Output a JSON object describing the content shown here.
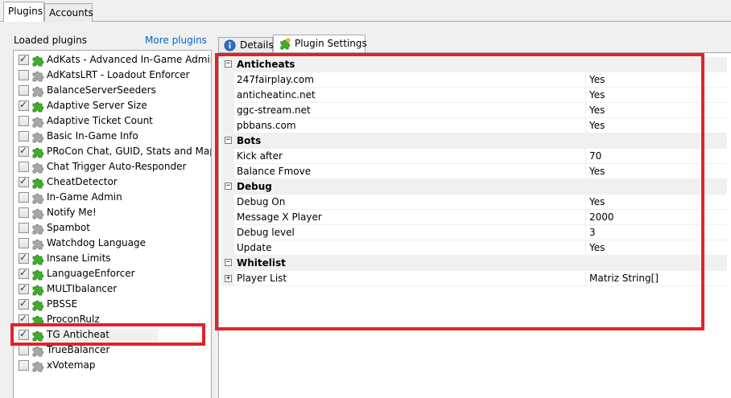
{
  "top_tabs": [
    {
      "label": "Plugins",
      "active": true
    },
    {
      "label": "Accounts",
      "active": false
    }
  ],
  "plugins_panel": {
    "title": "Loaded plugins",
    "more_link": "More plugins",
    "items": [
      {
        "name": "AdKats - Advanced In-Game Admin",
        "checked": true,
        "enabled": true
      },
      {
        "name": "AdKatsLRT - Loadout Enforcer",
        "checked": false,
        "enabled": false
      },
      {
        "name": "BalanceServerSeeders",
        "checked": false,
        "enabled": false
      },
      {
        "name": "Adaptive Server Size",
        "checked": true,
        "enabled": true
      },
      {
        "name": "Adaptive Ticket Count",
        "checked": false,
        "enabled": false
      },
      {
        "name": "Basic In-Game Info",
        "checked": false,
        "enabled": false
      },
      {
        "name": "PRoCon Chat, GUID, Stats and Map Logger",
        "checked": true,
        "enabled": true
      },
      {
        "name": "Chat Trigger Auto-Responder",
        "checked": false,
        "enabled": false
      },
      {
        "name": "CheatDetector",
        "checked": true,
        "enabled": true
      },
      {
        "name": "In-Game Admin",
        "checked": false,
        "enabled": false
      },
      {
        "name": "Notify Me!",
        "checked": false,
        "enabled": false
      },
      {
        "name": "Spambot",
        "checked": false,
        "enabled": false
      },
      {
        "name": "Watchdog Language",
        "checked": false,
        "enabled": false
      },
      {
        "name": "Insane Limits",
        "checked": true,
        "enabled": true
      },
      {
        "name": "LanguageEnforcer",
        "checked": true,
        "enabled": true
      },
      {
        "name": "MULTIbalancer",
        "checked": true,
        "enabled": true
      },
      {
        "name": "PBSSE",
        "checked": true,
        "enabled": true
      },
      {
        "name": "ProconRulz",
        "checked": true,
        "enabled": true
      },
      {
        "name": "TG Anticheat",
        "checked": true,
        "enabled": true,
        "selected": true
      },
      {
        "name": "TrueBalancer",
        "checked": false,
        "enabled": false
      },
      {
        "name": "xVotemap",
        "checked": false,
        "enabled": false
      }
    ]
  },
  "right_tabs": [
    {
      "label": "Details",
      "icon": "info-icon",
      "active": false
    },
    {
      "label": "Plugin Settings",
      "icon": "puzzle-icon",
      "active": true
    }
  ],
  "settings": {
    "categories": [
      {
        "name": "Anticheats",
        "expanded": true,
        "props": [
          {
            "name": "247fairplay.com",
            "value": "Yes"
          },
          {
            "name": "anticheatinc.net",
            "value": "Yes"
          },
          {
            "name": "ggc-stream.net",
            "value": "Yes"
          },
          {
            "name": "pbbans.com",
            "value": "Yes"
          }
        ]
      },
      {
        "name": "Bots",
        "expanded": true,
        "props": [
          {
            "name": "Kick after",
            "value": "70"
          },
          {
            "name": "Balance Fmove",
            "value": "Yes"
          }
        ]
      },
      {
        "name": "Debug",
        "expanded": true,
        "props": [
          {
            "name": "Debug On",
            "value": "Yes"
          },
          {
            "name": "Message X Player",
            "value": "2000"
          },
          {
            "name": "Debug level",
            "value": "3"
          },
          {
            "name": "Update",
            "value": "Yes"
          }
        ]
      },
      {
        "name": "Whitelist",
        "expanded": true,
        "props": [
          {
            "name": "Player List",
            "value": "Matriz String[]",
            "expandable": true
          }
        ]
      }
    ]
  },
  "colors": {
    "highlight": "#e3222a",
    "puzzle_enabled": "#3fae2a",
    "puzzle_disabled": "#a8a8a8",
    "link": "#0066cc"
  }
}
